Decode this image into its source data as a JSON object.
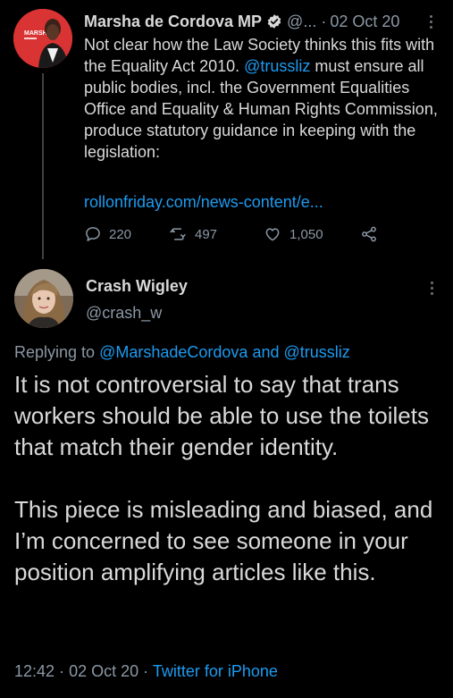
{
  "parent_tweet": {
    "author_name": "Marsha de Cordova MP",
    "handle": "@...",
    "separator": "·",
    "date": "02 Oct 20",
    "avatar_text": "MARSHA",
    "text_part1": "Not clear how the Law Society thinks this fits with the Equality Act 2010. ",
    "mention": "@trussliz",
    "text_part2": " must ensure all public bodies, incl. the Government Equalities Office and Equality & Human Rights Commission, produce statutory guidance in keeping with the legislation:",
    "link": "rollonfriday.com/news-content/e...",
    "replies": "220",
    "retweets": "497",
    "likes": "1,050",
    "icons": [
      "verified-icon",
      "more-icon",
      "reply-icon",
      "retweet-icon",
      "like-icon",
      "share-icon"
    ]
  },
  "main_tweet": {
    "author_name": "Crash Wigley",
    "handle": "@crash_w",
    "replying_prefix": "Replying to",
    "replying_mention1": "@MarshadeCordova",
    "replying_and": "and",
    "replying_mention2": "@trussliz",
    "paragraph1": "It is not controversial to say that trans workers should be able to use the toilets that match their gender identity.",
    "paragraph2": "This piece is misleading and biased, and I’m concerned to see someone in your position amplifying articles like this.",
    "time": "12:42",
    "date": "02 Oct 20",
    "separator": "·",
    "client": "Twitter for iPhone"
  },
  "colors": {
    "background": "#000000",
    "text": "#d9d9d9",
    "secondary": "#8b98a5",
    "accent": "#1d9bf0"
  }
}
